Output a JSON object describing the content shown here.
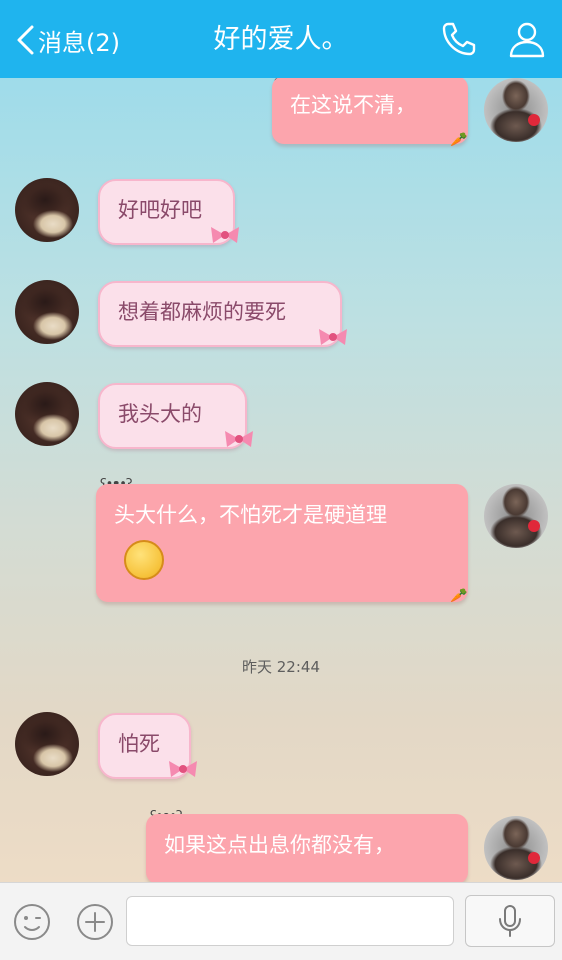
{
  "header": {
    "back_label": "消息(2)",
    "title": "好的爱人。"
  },
  "messages": [
    {
      "sender": "self",
      "text": "在这说不清，"
    },
    {
      "sender": "other",
      "text": "好吧好吧"
    },
    {
      "sender": "other",
      "text": "想着都麻烦的要死"
    },
    {
      "sender": "other",
      "text": "我头大的"
    },
    {
      "sender": "self",
      "text": "头大什么，不怕死才是硬道理"
    },
    {
      "sender": "other",
      "text": "怕死"
    },
    {
      "sender": "self",
      "text": "如果这点出息你都没有，"
    }
  ],
  "timestamp": "昨天 22:44",
  "input": {
    "value": "",
    "placeholder": ""
  },
  "colors": {
    "header_bg": "#1fb4ee",
    "incoming_bubble": "#fbe0ea",
    "outgoing_bubble": "#fca5ad"
  },
  "icons": [
    "chevron-left-icon",
    "phone-icon",
    "contact-icon",
    "emoji-icon",
    "plus-icon",
    "microphone-icon"
  ]
}
